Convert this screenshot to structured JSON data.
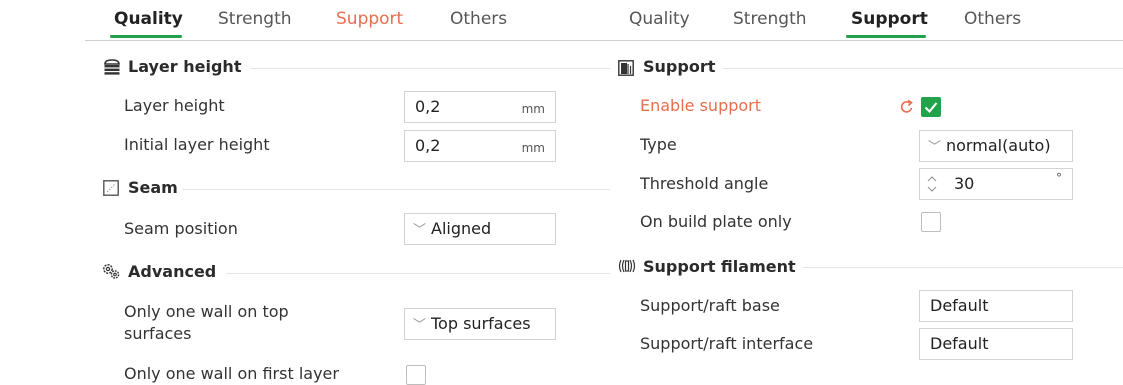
{
  "left_panel": {
    "tabs": [
      {
        "label": "Quality"
      },
      {
        "label": "Strength"
      },
      {
        "label": "Support"
      },
      {
        "label": "Others"
      }
    ],
    "sections": {
      "layer_height": {
        "title": "Layer height",
        "rows": [
          {
            "label": "Layer height",
            "value": "0,2",
            "unit": "mm"
          },
          {
            "label": "Initial layer height",
            "value": "0,2",
            "unit": "mm"
          }
        ]
      },
      "seam": {
        "title": "Seam",
        "rows": [
          {
            "label": "Seam position",
            "value": "Aligned"
          }
        ]
      },
      "advanced": {
        "title": "Advanced",
        "rows": [
          {
            "label_line1": "Only one wall on top",
            "label_line2": "surfaces",
            "value": "Top surfaces"
          },
          {
            "label": "Only one wall on first layer",
            "checked": false
          }
        ]
      }
    }
  },
  "right_panel": {
    "tabs": [
      {
        "label": "Quality"
      },
      {
        "label": "Strength"
      },
      {
        "label": "Support"
      },
      {
        "label": "Others"
      }
    ],
    "sections": {
      "support": {
        "title": "Support",
        "rows": [
          {
            "label": "Enable support",
            "checked": true
          },
          {
            "label": "Type",
            "value": "normal(auto)"
          },
          {
            "label": "Threshold angle",
            "value": "30",
            "unit": "°"
          },
          {
            "label": "On build plate only",
            "checked": false
          }
        ]
      },
      "support_filament": {
        "title": "Support filament",
        "rows": [
          {
            "label": "Support/raft base",
            "value": "Default"
          },
          {
            "label": "Support/raft interface",
            "value": "Default"
          }
        ]
      }
    }
  },
  "colors": {
    "accent_green": "#22a24a",
    "modified_orange": "#e96e4c"
  },
  "icons": [
    "layers-icon",
    "seam-icon",
    "advanced-gear-icon",
    "support-icon",
    "support-filament-icon",
    "reset-arrow-icon",
    "checkmark-icon",
    "chevron-down-icon",
    "spin-arrows-icon"
  ]
}
